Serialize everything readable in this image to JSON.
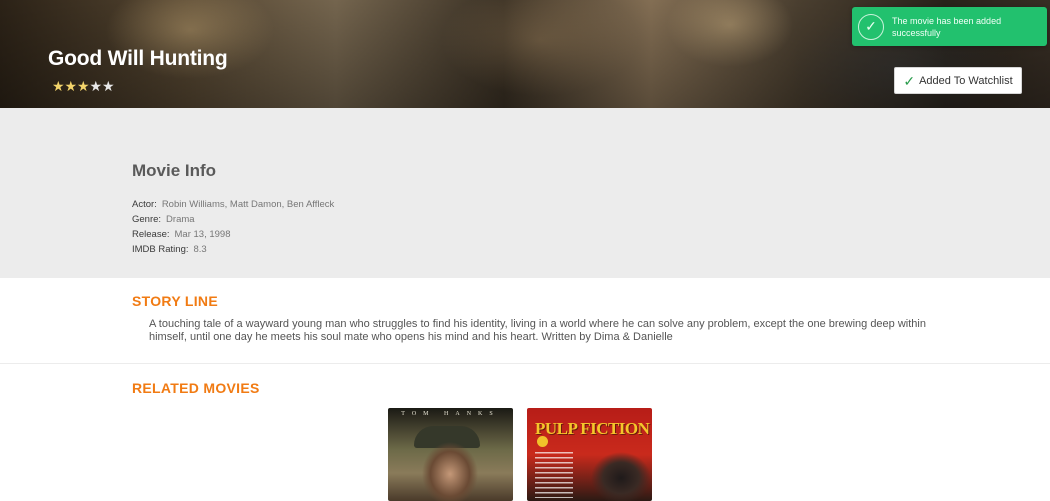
{
  "movie": {
    "title": "Good Will Hunting",
    "rating_stars": {
      "filled": 3,
      "total": 5
    }
  },
  "watchlist_button": {
    "label": "Added To Watchlist",
    "icon": "check-icon"
  },
  "toast": {
    "message": "The movie has been added successfully",
    "icon": "check-circle-icon",
    "color": "#22c16e"
  },
  "info": {
    "title": "Movie Info",
    "rows": [
      {
        "label": "Actor:",
        "value": "Robin Williams, Matt Damon, Ben Affleck"
      },
      {
        "label": "Genre:",
        "value": "Drama"
      },
      {
        "label": "Release:",
        "value": "Mar 13, 1998"
      },
      {
        "label": "IMDB Rating:",
        "value": "8.3"
      }
    ]
  },
  "story": {
    "heading": "STORY LINE",
    "text": "A touching tale of a wayward young man who struggles to find his identity, living in a world where he can solve any problem, except the one brewing deep within himself, until one day he meets his soul mate who opens his mind and his heart. Written by Dima & Danielle"
  },
  "related": {
    "heading": "RELATED MOVIES",
    "posters": [
      {
        "caption": "TOM HANKS"
      },
      {
        "logo": "PULP FICTION"
      }
    ]
  },
  "colors": {
    "accent": "#f17b13",
    "info_bg": "#ececec",
    "star": "#f3d46b"
  }
}
